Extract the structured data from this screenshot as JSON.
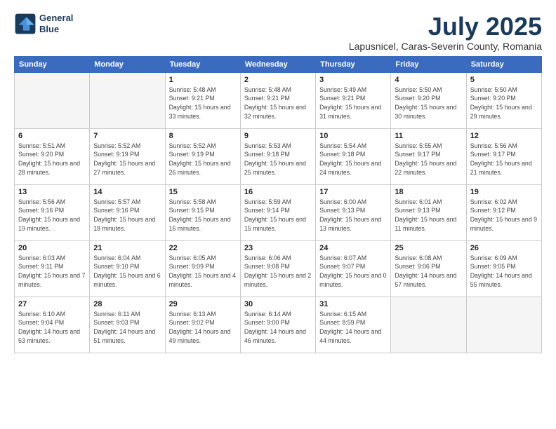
{
  "header": {
    "logo_line1": "General",
    "logo_line2": "Blue",
    "month_title": "July 2025",
    "subtitle": "Lapusnicel, Caras-Severin County, Romania"
  },
  "days_of_week": [
    "Sunday",
    "Monday",
    "Tuesday",
    "Wednesday",
    "Thursday",
    "Friday",
    "Saturday"
  ],
  "weeks": [
    [
      {
        "day": "",
        "empty": true
      },
      {
        "day": "",
        "empty": true
      },
      {
        "day": "1",
        "detail": "Sunrise: 5:48 AM\nSunset: 9:21 PM\nDaylight: 15 hours\nand 33 minutes."
      },
      {
        "day": "2",
        "detail": "Sunrise: 5:48 AM\nSunset: 9:21 PM\nDaylight: 15 hours\nand 32 minutes."
      },
      {
        "day": "3",
        "detail": "Sunrise: 5:49 AM\nSunset: 9:21 PM\nDaylight: 15 hours\nand 31 minutes."
      },
      {
        "day": "4",
        "detail": "Sunrise: 5:50 AM\nSunset: 9:20 PM\nDaylight: 15 hours\nand 30 minutes."
      },
      {
        "day": "5",
        "detail": "Sunrise: 5:50 AM\nSunset: 9:20 PM\nDaylight: 15 hours\nand 29 minutes."
      }
    ],
    [
      {
        "day": "6",
        "detail": "Sunrise: 5:51 AM\nSunset: 9:20 PM\nDaylight: 15 hours\nand 28 minutes."
      },
      {
        "day": "7",
        "detail": "Sunrise: 5:52 AM\nSunset: 9:19 PM\nDaylight: 15 hours\nand 27 minutes."
      },
      {
        "day": "8",
        "detail": "Sunrise: 5:52 AM\nSunset: 9:19 PM\nDaylight: 15 hours\nand 26 minutes."
      },
      {
        "day": "9",
        "detail": "Sunrise: 5:53 AM\nSunset: 9:18 PM\nDaylight: 15 hours\nand 25 minutes."
      },
      {
        "day": "10",
        "detail": "Sunrise: 5:54 AM\nSunset: 9:18 PM\nDaylight: 15 hours\nand 24 minutes."
      },
      {
        "day": "11",
        "detail": "Sunrise: 5:55 AM\nSunset: 9:17 PM\nDaylight: 15 hours\nand 22 minutes."
      },
      {
        "day": "12",
        "detail": "Sunrise: 5:56 AM\nSunset: 9:17 PM\nDaylight: 15 hours\nand 21 minutes."
      }
    ],
    [
      {
        "day": "13",
        "detail": "Sunrise: 5:56 AM\nSunset: 9:16 PM\nDaylight: 15 hours\nand 19 minutes."
      },
      {
        "day": "14",
        "detail": "Sunrise: 5:57 AM\nSunset: 9:16 PM\nDaylight: 15 hours\nand 18 minutes."
      },
      {
        "day": "15",
        "detail": "Sunrise: 5:58 AM\nSunset: 9:15 PM\nDaylight: 15 hours\nand 16 minutes."
      },
      {
        "day": "16",
        "detail": "Sunrise: 5:59 AM\nSunset: 9:14 PM\nDaylight: 15 hours\nand 15 minutes."
      },
      {
        "day": "17",
        "detail": "Sunrise: 6:00 AM\nSunset: 9:13 PM\nDaylight: 15 hours\nand 13 minutes."
      },
      {
        "day": "18",
        "detail": "Sunrise: 6:01 AM\nSunset: 9:13 PM\nDaylight: 15 hours\nand 11 minutes."
      },
      {
        "day": "19",
        "detail": "Sunrise: 6:02 AM\nSunset: 9:12 PM\nDaylight: 15 hours\nand 9 minutes."
      }
    ],
    [
      {
        "day": "20",
        "detail": "Sunrise: 6:03 AM\nSunset: 9:11 PM\nDaylight: 15 hours\nand 7 minutes."
      },
      {
        "day": "21",
        "detail": "Sunrise: 6:04 AM\nSunset: 9:10 PM\nDaylight: 15 hours\nand 6 minutes."
      },
      {
        "day": "22",
        "detail": "Sunrise: 6:05 AM\nSunset: 9:09 PM\nDaylight: 15 hours\nand 4 minutes."
      },
      {
        "day": "23",
        "detail": "Sunrise: 6:06 AM\nSunset: 9:08 PM\nDaylight: 15 hours\nand 2 minutes."
      },
      {
        "day": "24",
        "detail": "Sunrise: 6:07 AM\nSunset: 9:07 PM\nDaylight: 15 hours\nand 0 minutes."
      },
      {
        "day": "25",
        "detail": "Sunrise: 6:08 AM\nSunset: 9:06 PM\nDaylight: 14 hours\nand 57 minutes."
      },
      {
        "day": "26",
        "detail": "Sunrise: 6:09 AM\nSunset: 9:05 PM\nDaylight: 14 hours\nand 55 minutes."
      }
    ],
    [
      {
        "day": "27",
        "detail": "Sunrise: 6:10 AM\nSunset: 9:04 PM\nDaylight: 14 hours\nand 53 minutes."
      },
      {
        "day": "28",
        "detail": "Sunrise: 6:11 AM\nSunset: 9:03 PM\nDaylight: 14 hours\nand 51 minutes."
      },
      {
        "day": "29",
        "detail": "Sunrise: 6:13 AM\nSunset: 9:02 PM\nDaylight: 14 hours\nand 49 minutes."
      },
      {
        "day": "30",
        "detail": "Sunrise: 6:14 AM\nSunset: 9:00 PM\nDaylight: 14 hours\nand 46 minutes."
      },
      {
        "day": "31",
        "detail": "Sunrise: 6:15 AM\nSunset: 8:59 PM\nDaylight: 14 hours\nand 44 minutes."
      },
      {
        "day": "",
        "empty": true
      },
      {
        "day": "",
        "empty": true
      }
    ]
  ]
}
